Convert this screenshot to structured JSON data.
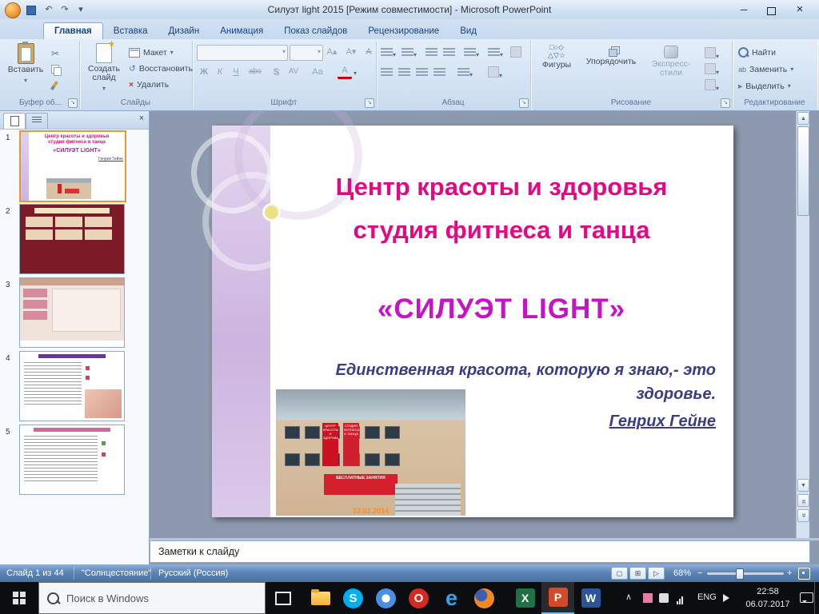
{
  "titlebar": {
    "title": "Силуэт light 2015 [Режим совместимости] - Microsoft PowerPoint"
  },
  "ribbon_tabs": [
    {
      "label": "Главная"
    },
    {
      "label": "Вставка"
    },
    {
      "label": "Дизайн"
    },
    {
      "label": "Анимация"
    },
    {
      "label": "Показ слайдов"
    },
    {
      "label": "Рецензирование"
    },
    {
      "label": "Вид"
    }
  ],
  "ribbon": {
    "clipboard": {
      "group_label": "Буфер об...",
      "paste": "Вставить"
    },
    "slides": {
      "group_label": "Слайды",
      "new_slide": "Создать слайд",
      "layout": "Макет",
      "reset": "Восстановить",
      "del": "Удалить"
    },
    "font": {
      "group_label": "Шрифт",
      "bold": "Ж",
      "italic": "К",
      "underline": "Ч",
      "strike": "abc",
      "shadow": "S",
      "spacing": "AV",
      "case_btn": "Аа",
      "color": "А",
      "grow": "А▴",
      "shrink": "А▾",
      "clear": "А"
    },
    "paragraph": {
      "group_label": "Абзац"
    },
    "drawing": {
      "group_label": "Рисование",
      "shapes": "Фигуры",
      "arrange": "Упорядочить",
      "styles": "Экспресс-стили"
    },
    "editing": {
      "group_label": "Редактирование",
      "find": "Найти",
      "replace": "Заменить",
      "select": "Выделить"
    }
  },
  "slides_panel": {
    "numbers": [
      "1",
      "2",
      "3",
      "4",
      "5"
    ]
  },
  "slide": {
    "title1": "Центр красоты и здоровья",
    "title2": "студия фитнеса и танца",
    "brand": "«СИЛУЭТ   LIGHT»",
    "quote1": "Единственная красота, которую я знаю,- это",
    "quote2": "здоровье.",
    "author": "Генрих Гейне",
    "photo": {
      "sign_left": "ЦЕНТР КРАСОТЫ И ЗДОРОВЬЯ",
      "sign_right": "СТУДИЯ ФИТНЕСА И ТАНЦА",
      "banner": "БЕСПЛАТНЫЕ ЗАНЯТИЯ",
      "date_stamp": "13.02.2014"
    }
  },
  "notes": {
    "placeholder": "Заметки к слайду"
  },
  "status": {
    "slide_info": "Слайд 1 из 44",
    "theme": "\"Солнцестояние\"",
    "language": "Русский (Россия)",
    "zoom": "68%"
  },
  "taskbar": {
    "search": "Поиск в Windows",
    "lang": "ENG",
    "time": "22:58",
    "date": "06.07.2017"
  },
  "icons": {
    "minimize": "─",
    "close": "×",
    "caret": "▾",
    "scroll_up": "▲",
    "scroll_down": "▼",
    "dbl_chevron": "«",
    "tray_chevron": "∧",
    "scissors": "✂",
    "reset_arrow": "↺",
    "delete_x": "×",
    "launcher": "↘",
    "star": "★",
    "view_normal": "◻",
    "view_sorter": "⊞",
    "view_show": "▷",
    "select_arrow": "▸",
    "minus": "−",
    "plus": "+",
    "replace_ab": "ab",
    "skype": "S",
    "opera": "O",
    "edge": "e",
    "excel": "X",
    "powerpoint": "P",
    "word": "W",
    "shapes_row1": "□○◇",
    "shapes_row2": "△▽☆"
  },
  "colors": {
    "title_pink": "#e10a84",
    "brand_purple": "#c513c5",
    "quote_indigo": "#3d3a88"
  }
}
